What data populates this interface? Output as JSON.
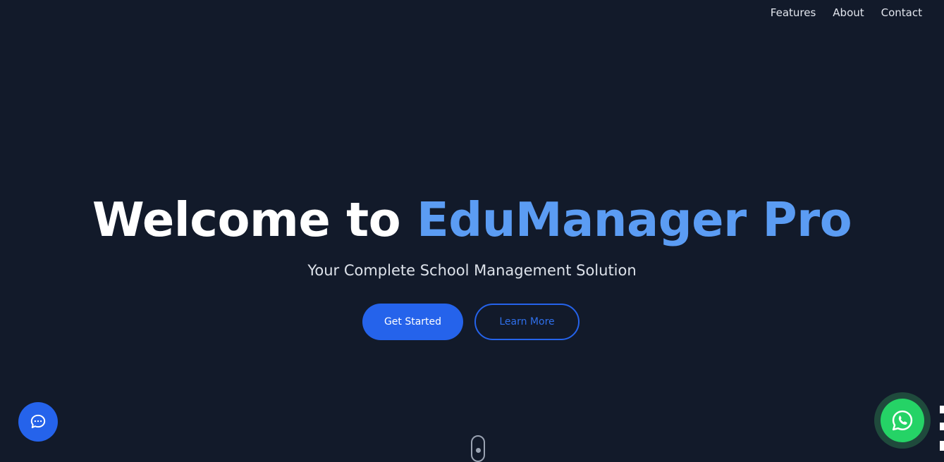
{
  "nav": {
    "items": [
      {
        "label": "Features"
      },
      {
        "label": "About"
      },
      {
        "label": "Contact"
      }
    ]
  },
  "hero": {
    "title_prefix": "Welcome to ",
    "title_brand": "EduManager Pro",
    "subtitle": "Your Complete School Management Solution",
    "primary_button": "Get Started",
    "secondary_button": "Learn More"
  },
  "floating": {
    "chat_icon": "chat-bubble-icon",
    "whatsapp_icon": "whatsapp-icon",
    "scroll_icon": "mouse-scroll-icon"
  },
  "colors": {
    "background": "#121a2a",
    "accent": "#5b9cf3",
    "primary": "#2563eb",
    "whatsapp": "#25d366"
  }
}
